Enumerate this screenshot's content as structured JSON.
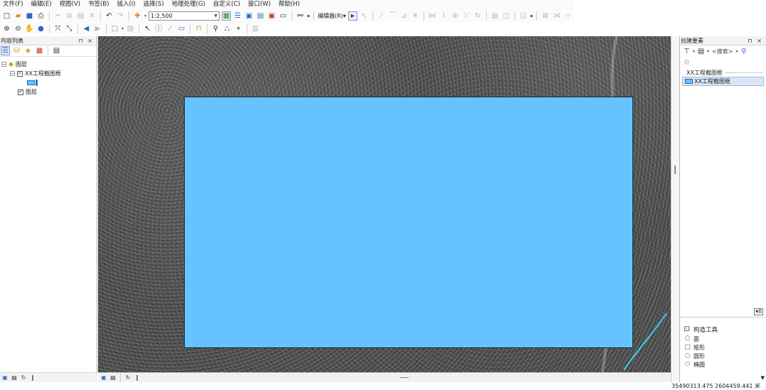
{
  "menu": [
    "文件(F)",
    "编辑(E)",
    "视图(V)",
    "书签(B)",
    "插入(I)",
    "选择(S)",
    "地理处理(G)",
    "自定义(C)",
    "窗口(W)",
    "帮助(H)"
  ],
  "toolbar": {
    "scale": "1:2,500",
    "editor_label": "编辑器(R)▾"
  },
  "toc": {
    "title": "内容列表",
    "panel_controls": "⊓ ×",
    "root_layer": "图层",
    "feature_layer": "XX工程截图框",
    "image_layer": "图层"
  },
  "create_features": {
    "title": "创建要素",
    "panel_controls": "⊓ ×",
    "search_placeholder": "<搜索>",
    "group_label": "XX工程截图框",
    "template_label": "XX工程截图框"
  },
  "construction_tools": {
    "title": "构造工具",
    "tools": [
      "面",
      "矩形",
      "圆形",
      "椭圆"
    ]
  },
  "status": {
    "coordinates": "35490313.475  2604459.441 米"
  },
  "colors": {
    "feature_fill": "#65c3ff",
    "feature_outline": "#0b2a3c",
    "river": "#34d3e8"
  }
}
